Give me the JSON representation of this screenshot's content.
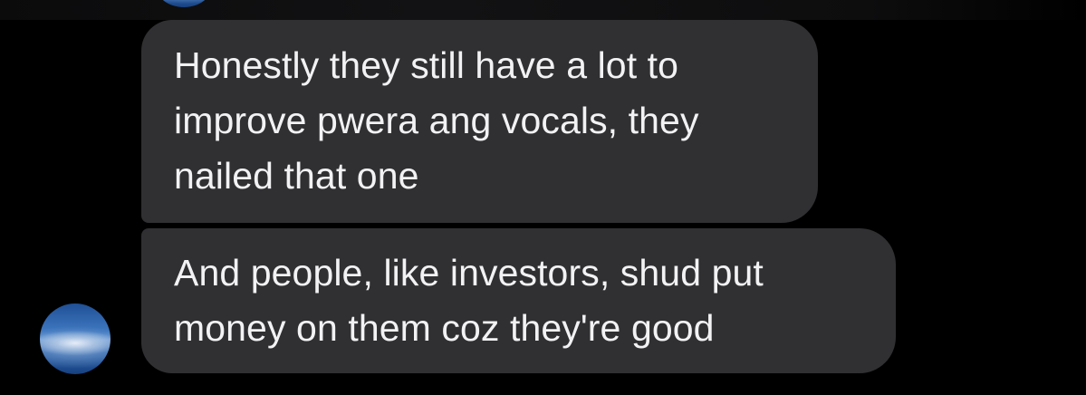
{
  "conversation": {
    "messages": [
      {
        "lines": [
          "Honestly they still have a lot to",
          "improve pwera ang vocals, they",
          "nailed that one"
        ]
      },
      {
        "lines": [
          "And people, like investors, shud put",
          "money on them coz they're good"
        ]
      }
    ]
  }
}
